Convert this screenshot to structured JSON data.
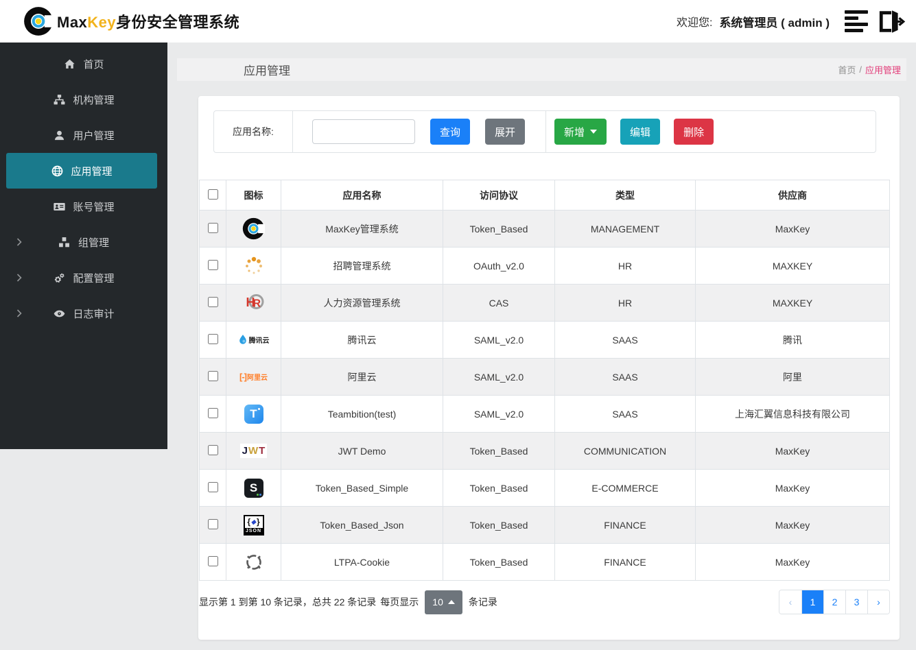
{
  "header": {
    "brand_max": "Max",
    "brand_key": "Key",
    "brand_suffix": "身份安全管理系统",
    "welcome_label": "欢迎您:",
    "user_label": "系统管理员 ( admin )"
  },
  "sidebar": {
    "items": [
      {
        "label": "首页",
        "icon": "home",
        "active": false,
        "expandable": false
      },
      {
        "label": "机构管理",
        "icon": "sitemap",
        "active": false,
        "expandable": false
      },
      {
        "label": "用户管理",
        "icon": "user",
        "active": false,
        "expandable": false
      },
      {
        "label": "应用管理",
        "icon": "globe",
        "active": true,
        "expandable": false
      },
      {
        "label": "账号管理",
        "icon": "id-card",
        "active": false,
        "expandable": false
      },
      {
        "label": "组管理",
        "icon": "cubes",
        "active": false,
        "expandable": true
      },
      {
        "label": "配置管理",
        "icon": "gears",
        "active": false,
        "expandable": true
      },
      {
        "label": "日志审计",
        "icon": "eye",
        "active": false,
        "expandable": true
      }
    ]
  },
  "page": {
    "title": "应用管理",
    "breadcrumb_home": "首页",
    "breadcrumb_sep": "/",
    "breadcrumb_current": "应用管理"
  },
  "toolbar": {
    "search_label": "应用名称:",
    "search_value": "",
    "query_label": "查询",
    "expand_label": "展开",
    "add_label": "新增",
    "edit_label": "编辑",
    "delete_label": "删除"
  },
  "table": {
    "col_icon": "图标",
    "col_name": "应用名称",
    "col_protocol": "访问协议",
    "col_type": "类型",
    "col_vendor": "供应商",
    "rows": [
      {
        "icon": "maxkey",
        "name": "MaxKey管理系统",
        "protocol": "Token_Based",
        "type": "MANAGEMENT",
        "vendor": "MaxKey"
      },
      {
        "icon": "recruit",
        "name": "招聘管理系统",
        "protocol": "OAuth_v2.0",
        "type": "HR",
        "vendor": "MAXKEY"
      },
      {
        "icon": "hr",
        "name": "人力资源管理系统",
        "protocol": "CAS",
        "type": "HR",
        "vendor": "MAXKEY"
      },
      {
        "icon": "tencent-cloud",
        "name": "腾讯云",
        "protocol": "SAML_v2.0",
        "type": "SAAS",
        "vendor": "腾讯"
      },
      {
        "icon": "aliyun",
        "name": "阿里云",
        "protocol": "SAML_v2.0",
        "type": "SAAS",
        "vendor": "阿里"
      },
      {
        "icon": "teambition",
        "name": "Teambition(test)",
        "protocol": "SAML_v2.0",
        "type": "SAAS",
        "vendor": "上海汇翼信息科技有限公司"
      },
      {
        "icon": "jwt",
        "name": "JWT Demo",
        "protocol": "Token_Based",
        "type": "COMMUNICATION",
        "vendor": "MaxKey"
      },
      {
        "icon": "s-app",
        "name": "Token_Based_Simple",
        "protocol": "Token_Based",
        "type": "E-COMMERCE",
        "vendor": "MaxKey"
      },
      {
        "icon": "json",
        "name": "Token_Based_Json",
        "protocol": "Token_Based",
        "type": "FINANCE",
        "vendor": "MaxKey"
      },
      {
        "icon": "ltpa",
        "name": "LTPA-Cookie",
        "protocol": "Token_Based",
        "type": "FINANCE",
        "vendor": "MaxKey"
      }
    ]
  },
  "pagination": {
    "info": "显示第 1 到第 10 条记录，总共 22 条记录",
    "per_page_label": "每页显示",
    "per_page_value": "10",
    "per_page_suffix": "条记录",
    "prev": "‹",
    "next": "›",
    "pages": [
      "1",
      "2",
      "3"
    ],
    "active_page": "1"
  },
  "colors": {
    "accent_teal": "#1a7a8c",
    "primary_blue": "#1a80f8",
    "success_green": "#28a745",
    "info_teal": "#17a2b8",
    "danger_red": "#dc3545",
    "secondary_gray": "#6e757c",
    "breadcrumb_pink": "#e23d79",
    "brand_gold": "#f2b31c"
  }
}
